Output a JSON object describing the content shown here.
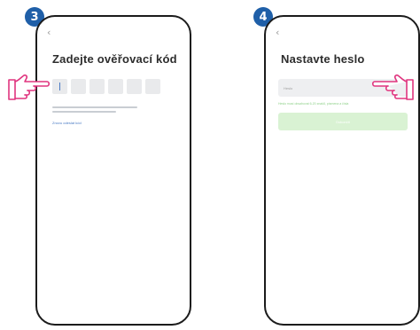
{
  "steps": [
    {
      "number": "3",
      "back_icon": "chevron-left-icon",
      "title": "Zadejte ověřovací kód",
      "code_box_count": 6,
      "resend_text": "Znovu odeslat kód"
    },
    {
      "number": "4",
      "back_icon": "chevron-left-icon",
      "title": "Nastavte heslo",
      "password_placeholder": "Heslo",
      "password_hint": "Heslo musí obsahovat 6-20 znaků, písmena a čísla",
      "submit_label": "Dokončit"
    }
  ],
  "colors": {
    "badge": "#1f5fa8",
    "link": "#4a7bc4",
    "hint_green": "#8fd18a",
    "button_disabled": "#d9f2d3"
  },
  "icons": {
    "pointer": "pointing-hand-icon"
  }
}
